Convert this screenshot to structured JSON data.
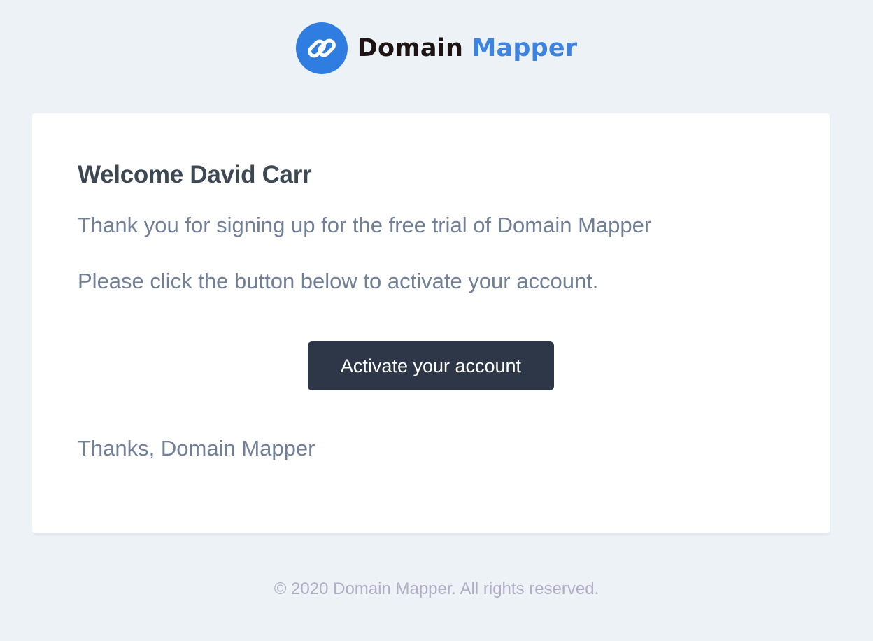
{
  "header": {
    "brand_name_dark": "Domain",
    "brand_name_accent": "Mapper",
    "logo_icon": "link-chain-icon",
    "brand_color": "#2f7de1"
  },
  "email": {
    "greeting": "Welcome David Carr",
    "line1": "Thank you for signing up for the free trial of Domain Mapper",
    "line2": "Please click the button below to activate your account.",
    "button_label": "Activate your account",
    "signoff": "Thanks, Domain Mapper"
  },
  "footer": {
    "copyright": "© 2020 Domain Mapper. All rights reserved."
  },
  "colors": {
    "background": "#edf2f7",
    "button": "#2d3748",
    "heading": "#3d4852",
    "body_text": "#718096",
    "accent": "#3d83e0"
  }
}
